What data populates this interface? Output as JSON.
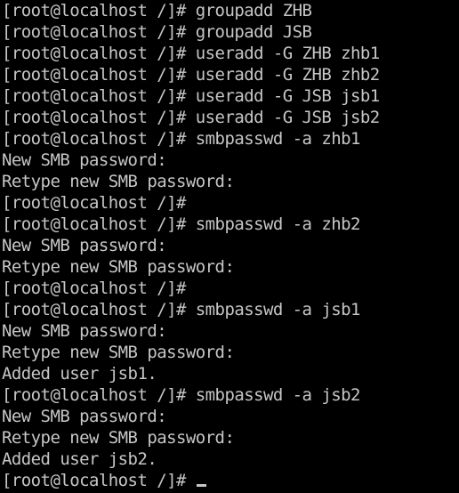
{
  "terminal": {
    "title": "root@localhost:/",
    "colors": {
      "background": "#000000",
      "foreground": "#c6c6c6",
      "cursor": "#c6c6c6"
    },
    "prompt": "[root@localhost /]#",
    "cursor_glyph": "underscore-cursor",
    "columns": 43,
    "rows": 23,
    "lines": [
      "[root@localhost /]# groupadd ZHB",
      "[root@localhost /]# groupadd JSB",
      "[root@localhost /]# useradd -G ZHB zhb1",
      "[root@localhost /]# useradd -G ZHB zhb2",
      "[root@localhost /]# useradd -G JSB jsb1",
      "[root@localhost /]# useradd -G JSB jsb2",
      "[root@localhost /]# smbpasswd -a zhb1",
      "New SMB password:",
      "Retype new SMB password:",
      "[root@localhost /]#",
      "[root@localhost /]# smbpasswd -a zhb2",
      "New SMB password:",
      "Retype new SMB password:",
      "[root@localhost /]#",
      "[root@localhost /]# smbpasswd -a jsb1",
      "New SMB password:",
      "Retype new SMB password:",
      "Added user jsb1.",
      "[root@localhost /]# smbpasswd -a jsb2",
      "New SMB password:",
      "Retype new SMB password:",
      "Added user jsb2.",
      "[root@localhost /]# "
    ],
    "last_line_index": 22
  }
}
